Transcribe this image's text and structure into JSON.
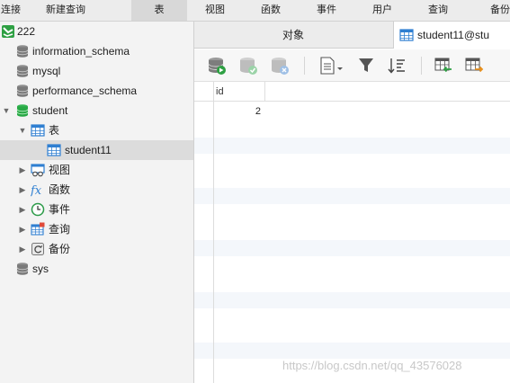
{
  "menu": {
    "items": [
      {
        "label": "连接"
      },
      {
        "label": "新建查询"
      },
      {
        "label": "表"
      },
      {
        "label": "视图"
      },
      {
        "label": "函数"
      },
      {
        "label": "事件"
      },
      {
        "label": "用户"
      },
      {
        "label": "查询"
      },
      {
        "label": "备份"
      }
    ],
    "active_label": "表"
  },
  "sidebar": {
    "connection": {
      "label": "222",
      "icon": "connection-icon"
    },
    "databases": [
      {
        "label": "information_schema",
        "icon": "database-icon"
      },
      {
        "label": "mysql",
        "icon": "database-icon"
      },
      {
        "label": "performance_schema",
        "icon": "database-icon"
      },
      {
        "label": "student",
        "icon": "database-open-icon",
        "expanded": true
      },
      {
        "label": "sys",
        "icon": "database-icon"
      }
    ],
    "student_children": [
      {
        "label": "表",
        "icon": "table-group-icon",
        "expanded": true
      },
      {
        "label": "student11",
        "icon": "table-icon",
        "selected": true
      },
      {
        "label": "视图",
        "icon": "view-icon"
      },
      {
        "label": "函数",
        "icon": "function-icon"
      },
      {
        "label": "事件",
        "icon": "event-clock-icon"
      },
      {
        "label": "查询",
        "icon": "query-icon"
      },
      {
        "label": "备份",
        "icon": "backup-icon"
      }
    ]
  },
  "tabs": {
    "objects_label": "对象",
    "table_label": "student11@stu"
  },
  "toolbar": {
    "buttons": [
      "add-record-icon",
      "save-record-icon",
      "delete-record-icon",
      "text-view-icon",
      "filter-icon",
      "sort-icon",
      "import-icon",
      "export-icon"
    ]
  },
  "grid": {
    "columns": [
      "id"
    ],
    "rows": [
      [
        "2"
      ]
    ]
  },
  "watermark": "https://blog.csdn.net/qq_43576028",
  "colors": {
    "database_green": "#27a844",
    "database_gray": "#8a8a8a",
    "table_blue": "#2f7fd1",
    "selection": "#dcdcdc",
    "stripe": "#f4f7fb"
  }
}
